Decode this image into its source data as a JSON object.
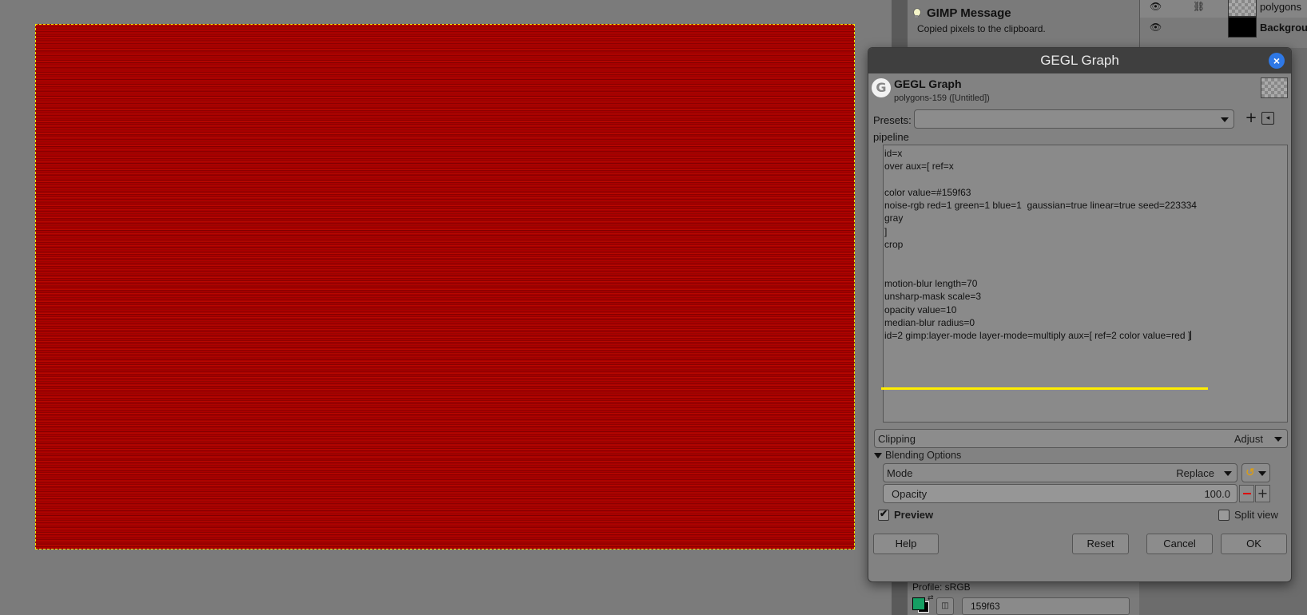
{
  "message": {
    "title": "GIMP Message",
    "text": "Copied pixels to the clipboard."
  },
  "layers": [
    {
      "name": "polygons",
      "thumb": "transparent",
      "selected": true
    },
    {
      "name": "Backgrour",
      "thumb": "black",
      "selected": false
    }
  ],
  "colors": {
    "canvas_fill": "#a80000",
    "selection": "#f2e600",
    "foreground": "#159f63",
    "highlight_underline": "#ffee00",
    "close_button": "#2e78e6"
  },
  "dialog": {
    "title": "GEGL Graph",
    "op_title": "GEGL Graph",
    "op_subtitle": "polygons-159 ([Untitled])",
    "presets_label": "Presets:",
    "presets_value": "",
    "pipeline_label": "pipeline",
    "pipeline_lines": [
      "id=x",
      "over aux=[ ref=x",
      "",
      "color value=#159f63",
      "noise-rgb red=1 green=1 blue=1  gaussian=true linear=true seed=223334",
      "gray",
      "]",
      "crop",
      "",
      "",
      "motion-blur length=70",
      "unsharp-mask scale=3",
      "opacity value=10",
      "median-blur radius=0",
      "id=2 gimp:layer-mode layer-mode=multiply aux=[ ref=2 color value=red ]"
    ],
    "clipping_label": "Clipping",
    "clipping_value": "Adjust",
    "blending_header": "Blending Options",
    "mode_label": "Mode",
    "mode_value": "Replace",
    "opacity_label": "Opacity",
    "opacity_value": "100.0",
    "preview_label": "Preview",
    "preview_checked": true,
    "split_view_label": "Split view",
    "split_view_checked": false,
    "buttons": {
      "help": "Help",
      "reset": "Reset",
      "cancel": "Cancel",
      "ok": "OK"
    }
  },
  "bottom": {
    "profile_label": "Profile: sRGB",
    "hex_value": "159f63"
  }
}
